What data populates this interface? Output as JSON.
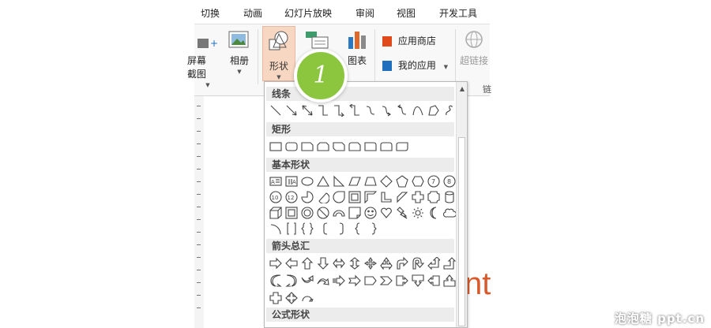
{
  "tabs": [
    {
      "label": "切换"
    },
    {
      "label": "动画"
    },
    {
      "label": "幻灯片放映"
    },
    {
      "label": "审阅"
    },
    {
      "label": "视图"
    },
    {
      "label": "开发工具"
    }
  ],
  "ribbon": {
    "screenshot_label": "屏幕截图",
    "album_label": "相册",
    "shapes_label": "形状",
    "chart_label": "图表",
    "app_store_label": "应用商店",
    "my_apps_label": "我的应用",
    "hyperlink_label": "超链接",
    "links_group_label": "链",
    "colors": {
      "shape_active": "#f7d7c2",
      "store_icon": "#e04a1a",
      "apps_icon": "#1f6fbf"
    }
  },
  "badge": {
    "number": "1",
    "color": "#8cc63f"
  },
  "dropdown": {
    "categories": [
      {
        "label": "线条"
      },
      {
        "label": "矩形"
      },
      {
        "label": "基本形状"
      },
      {
        "label": "箭头总汇"
      },
      {
        "label": "公式形状"
      }
    ]
  },
  "slide": {
    "partial_text": "nt"
  },
  "watermark": {
    "text": "泡泡糖 ppt.cn"
  }
}
